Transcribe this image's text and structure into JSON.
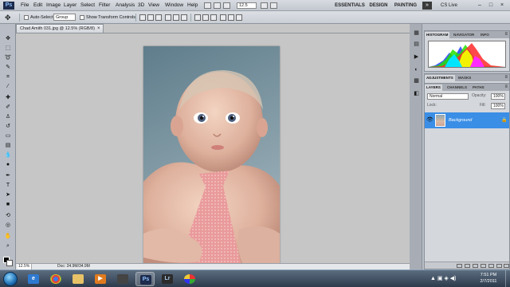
{
  "menubar": {
    "logo": "Ps",
    "items": [
      "File",
      "Edit",
      "Image",
      "Layer",
      "Select",
      "Filter",
      "Analysis",
      "3D",
      "View",
      "Window",
      "Help"
    ],
    "zoom_value": "12.5",
    "workspaces": [
      "ESSENTIALS",
      "DESIGN",
      "PAINTING"
    ],
    "more": "»",
    "cs_live": "CS Live",
    "window_controls": [
      "–",
      "□",
      "×"
    ]
  },
  "options": {
    "auto_select_label": "Auto-Select:",
    "auto_select_value": "Group",
    "show_transform_label": "Show Transform Controls"
  },
  "document": {
    "tab_title": "Chad Amith 031.jpg @ 12.5% (RGB/8)",
    "tab_close": "×",
    "status_zoom": "12.5%",
    "status_doc": "Doc: 34.9M/34.9M"
  },
  "histogram": {
    "tabs": [
      "HISTOGRAM",
      "NAVIGATOR",
      "INFO"
    ],
    "colors": {
      "red": "#ff2a2a",
      "green": "#25e000",
      "blue": "#1f3dff",
      "yellow": "#f2f200",
      "cyan": "#00e5ff",
      "magenta": "#ff2aff"
    }
  },
  "adjustments": {
    "tabs": [
      "ADJUSTMENTS",
      "MASKS"
    ]
  },
  "layers": {
    "tabs": [
      "LAYERS",
      "CHANNELS",
      "PATHS"
    ],
    "blend_mode": "Normal",
    "opacity_label": "Opacity:",
    "opacity_value": "100%",
    "lock_label": "Lock:",
    "fill_label": "Fill:",
    "fill_value": "100%",
    "layer_name": "Background",
    "layer_selected_color": "#3a8ee6"
  },
  "taskbar": {
    "apps": [
      "ie",
      "chrome",
      "explorer",
      "media",
      "unknown",
      "photoshop",
      "lightroom",
      "picasa"
    ],
    "clock_time": "7:51 PM",
    "clock_date": "2/7/2011"
  }
}
